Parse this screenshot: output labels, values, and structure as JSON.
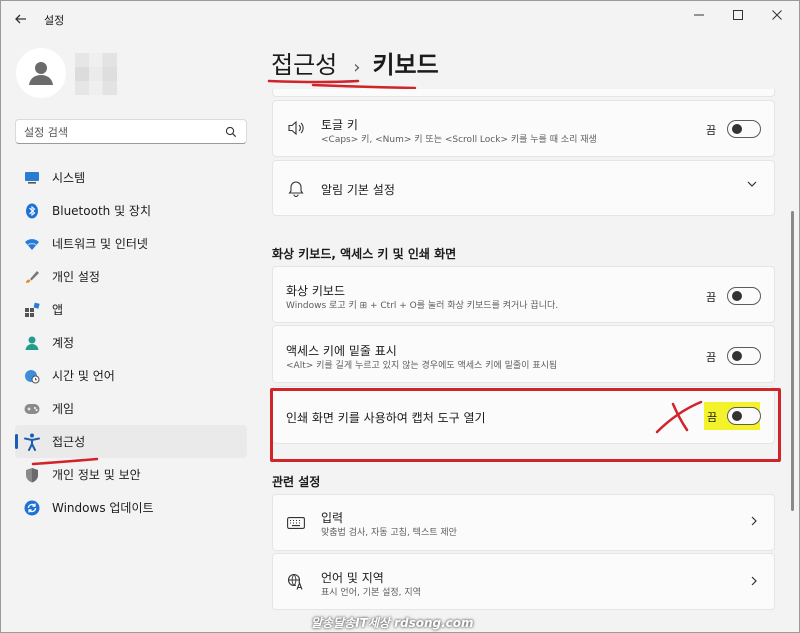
{
  "window": {
    "title": "설정"
  },
  "sidebar": {
    "search_placeholder": "설정 검색",
    "items": [
      {
        "label": "시스템",
        "icon": "monitor-icon"
      },
      {
        "label": "Bluetooth 및 장치",
        "icon": "bluetooth-icon"
      },
      {
        "label": "네트워크 및 인터넷",
        "icon": "wifi-icon"
      },
      {
        "label": "개인 설정",
        "icon": "brush-icon"
      },
      {
        "label": "앱",
        "icon": "apps-icon"
      },
      {
        "label": "계정",
        "icon": "account-icon"
      },
      {
        "label": "시간 및 언어",
        "icon": "globe-clock-icon"
      },
      {
        "label": "게임",
        "icon": "gamepad-icon"
      },
      {
        "label": "접근성",
        "icon": "accessibility-icon",
        "active": true
      },
      {
        "label": "개인 정보 및 보안",
        "icon": "shield-icon"
      },
      {
        "label": "Windows 업데이트",
        "icon": "update-icon"
      }
    ]
  },
  "breadcrumb": {
    "parent": "접근성",
    "separator": "›",
    "current": "키보드"
  },
  "cards": {
    "toggle_keys": {
      "title": "토글 키",
      "desc": "<Caps> 키, <Num> 키 또는 <Scroll Lock> 키를 누를 때 소리 재생",
      "state": "끔"
    },
    "notification": {
      "title": "알림 기본 설정"
    },
    "onscreen_keyboard": {
      "title": "화상 키보드",
      "desc": "Windows 로고 키 ⊞ + Ctrl + O를 눌러 화상 키보드를 켜거나 끕니다.",
      "state": "끔"
    },
    "access_keys": {
      "title": "액세스 키에 밑줄 표시",
      "desc": "<Alt> 키를 길게 누르고 있지 않는 경우에도 액세스 키에 밑줄이 표시됨",
      "state": "끔"
    },
    "print_screen": {
      "title": "인쇄 화면 키를 사용하여 캡처 도구 열기",
      "state": "끔"
    },
    "input": {
      "title": "입력",
      "desc": "맞춤법 검사, 자동 고침, 텍스트 제안"
    },
    "language": {
      "title": "언어 및 지역",
      "desc": "표시 언어, 기본 설정, 지역"
    }
  },
  "sections": {
    "keyboard_section": "화상 키보드, 액세스 키 및 인쇄 화면",
    "related": "관련 설정"
  },
  "watermark": "알송달송IT세상 rdsong.com",
  "colors": {
    "accent": "#1a5fb4",
    "annotation_red": "#d1232a",
    "highlight_yellow": "#f4f22b"
  }
}
